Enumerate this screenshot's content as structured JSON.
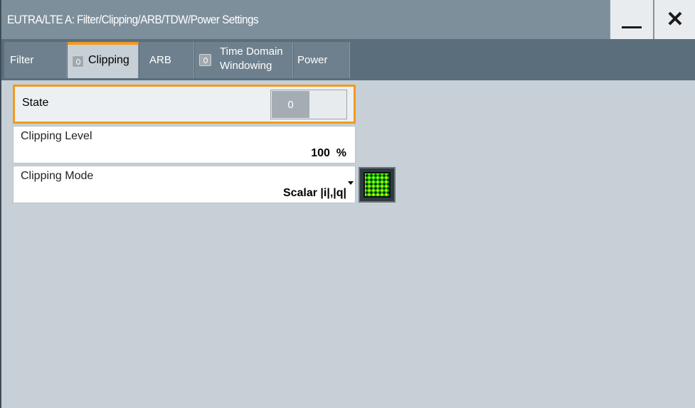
{
  "window": {
    "title": "EUTRA/LTE A: Filter/Clipping/ARB/TDW/Power Settings",
    "minimize_icon": "minimize-icon",
    "close_icon": "close-icon"
  },
  "tabs": [
    {
      "label": "Filter",
      "active": false,
      "has_led": false
    },
    {
      "label": "Clipping",
      "active": true,
      "has_led": true,
      "led_text": "O"
    },
    {
      "label": "ARB",
      "active": false,
      "has_led": false
    },
    {
      "label_line1": "Time Domain",
      "label_line2": "Windowing",
      "active": false,
      "has_led": true
    },
    {
      "label": "Power",
      "active": false,
      "has_led": false
    }
  ],
  "state": {
    "label": "State",
    "toggle_value": "0"
  },
  "clipping_level": {
    "label": "Clipping Level",
    "value": "100  %"
  },
  "clipping_mode": {
    "label": "Clipping Mode",
    "value": "Scalar |i|,|q|",
    "pattern_icon": "constellation-pattern-icon"
  },
  "colors": {
    "accent": "#f29a1f",
    "titlebar": "#7e8f9c",
    "tabbar": "#5a6e7c",
    "background": "#c7d0d6",
    "pattern_green": "#00cc00"
  }
}
